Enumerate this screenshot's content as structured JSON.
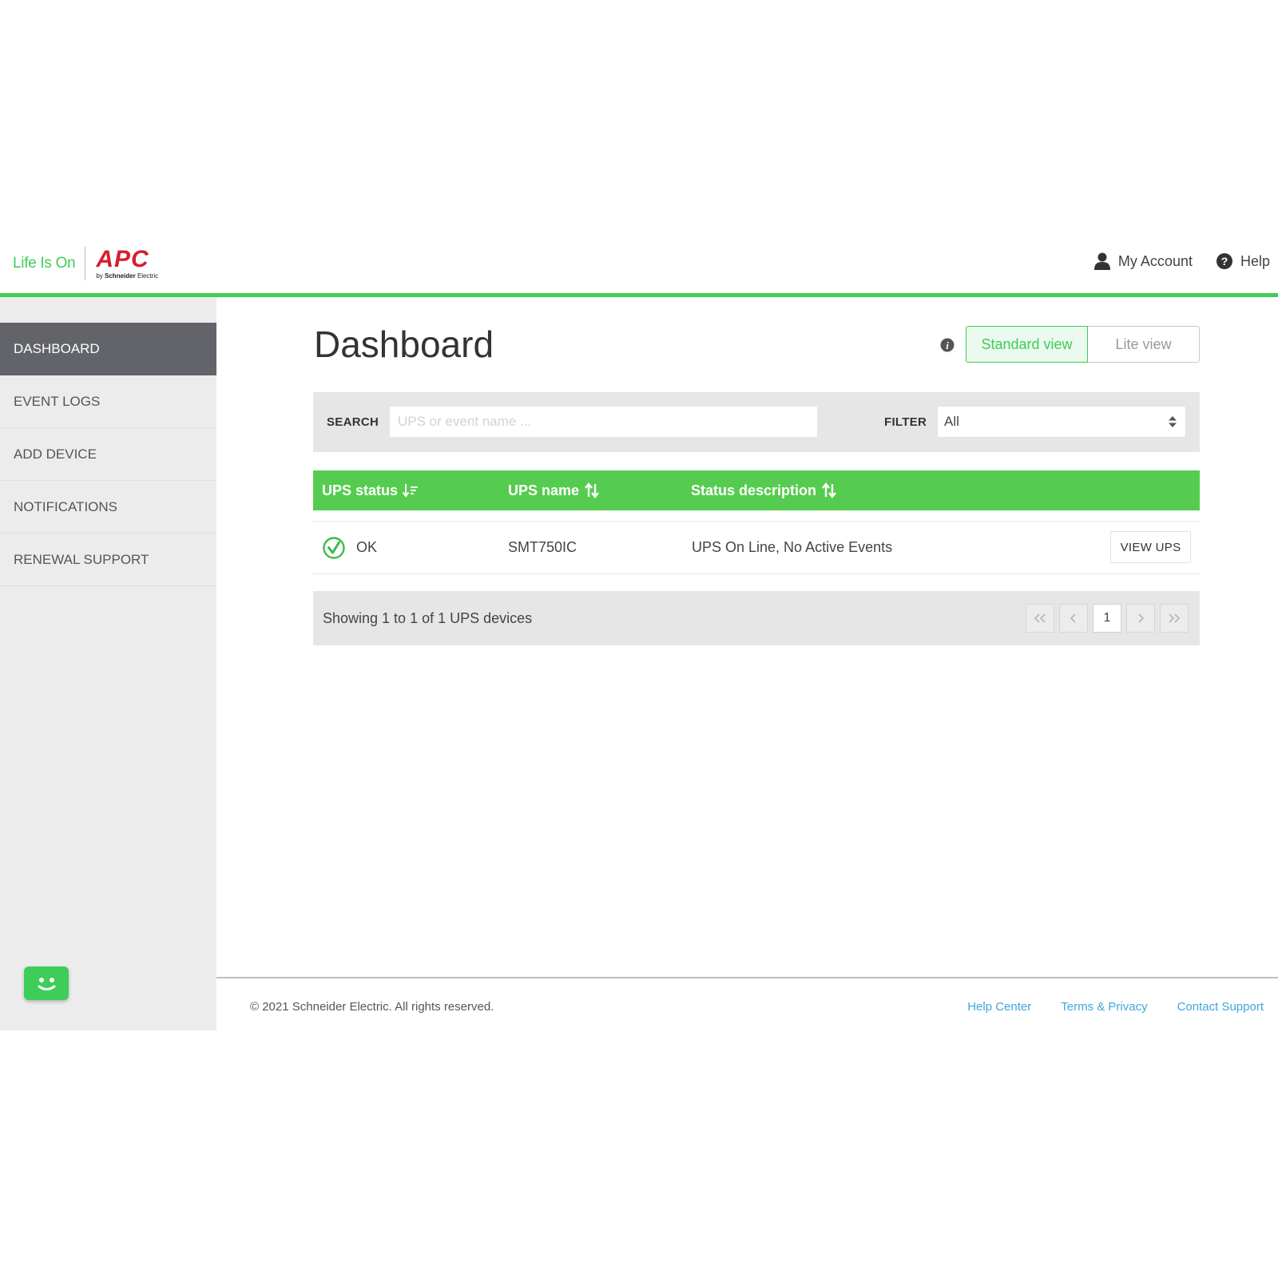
{
  "header": {
    "brand_tagline": "Life Is On",
    "logo_text": "APC",
    "logo_sub_prefix": "by",
    "logo_sub_brand": "Schneider",
    "logo_sub_suffix": "Electric",
    "my_account": "My Account",
    "help": "Help",
    "accent_color": "#3dcd58"
  },
  "sidebar": {
    "items": [
      {
        "label": "DASHBOARD",
        "active": true
      },
      {
        "label": "EVENT LOGS",
        "active": false
      },
      {
        "label": "ADD DEVICE",
        "active": false
      },
      {
        "label": "NOTIFICATIONS",
        "active": false
      },
      {
        "label": "RENEWAL SUPPORT",
        "active": false
      }
    ],
    "chat_icon": "chat-bot-icon"
  },
  "main": {
    "title": "Dashboard",
    "view_toggle": {
      "standard": "Standard view",
      "lite": "Lite view",
      "selected": "Standard view"
    },
    "search": {
      "label": "SEARCH",
      "placeholder": "UPS or event name ...",
      "value": ""
    },
    "filter": {
      "label": "FILTER",
      "value": "All"
    },
    "table": {
      "columns": [
        {
          "label": "UPS status",
          "icon": "sort-active-icon"
        },
        {
          "label": "UPS name",
          "icon": "sort-icon"
        },
        {
          "label": "Status description",
          "icon": "sort-icon"
        }
      ],
      "rows": [
        {
          "status": "OK",
          "status_icon": "check-circle-icon",
          "name": "SMT750IC",
          "description": "UPS On Line, No Active Events",
          "action": "VIEW UPS"
        }
      ]
    },
    "pagination": {
      "summary": "Showing 1 to 1 of 1 UPS devices",
      "first": "«",
      "prev": "‹",
      "current_page": "1",
      "next": "›",
      "last": "»"
    }
  },
  "footer": {
    "copyright": "© 2021 Schneider Electric. All rights reserved.",
    "links": [
      "Help Center",
      "Terms & Privacy",
      "Contact Support"
    ],
    "link_color": "#42a5dc"
  }
}
